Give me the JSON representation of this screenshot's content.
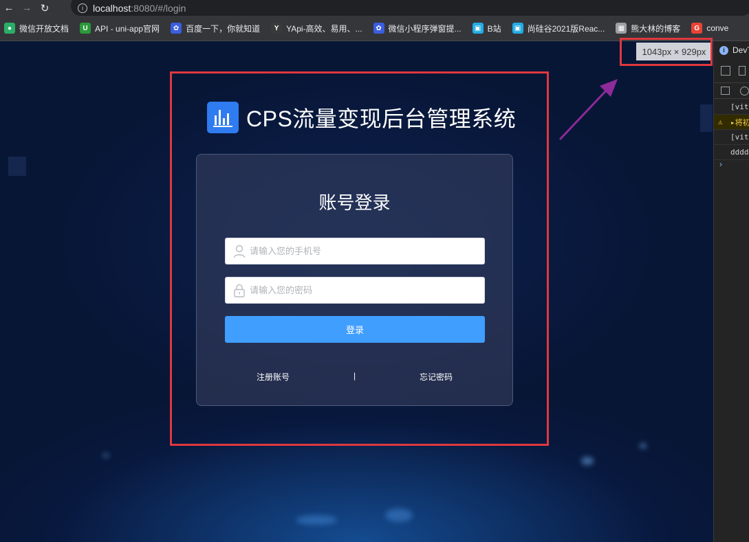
{
  "browser": {
    "url_host": "localhost",
    "url_rest": ":8080/#/login",
    "bookmarks": [
      {
        "label": "微信开放文档",
        "icon": "wechat-icon",
        "color": "#2aae67"
      },
      {
        "label": "API - uni-app官网",
        "icon": "uniapp-icon",
        "color": "#2b9939"
      },
      {
        "label": "百度一下，你就知道",
        "icon": "baidu-icon",
        "color": "#3b5ee0"
      },
      {
        "label": "YApi-高效、易用、...",
        "icon": "yapi-icon",
        "color": "#3a3a3a"
      },
      {
        "label": "微信小程序弹窗提...",
        "icon": "baidu-icon",
        "color": "#3b5ee0"
      },
      {
        "label": "B站",
        "icon": "bilibili-icon",
        "color": "#23ade5"
      },
      {
        "label": "尚硅谷2021版Reac...",
        "icon": "bilibili-icon",
        "color": "#23ade5"
      },
      {
        "label": "熊大林的博客",
        "icon": "blog-avatar-icon",
        "color": "#9aa0a6"
      },
      {
        "label": "conve",
        "icon": "google-icon",
        "color": "#ea4335"
      }
    ]
  },
  "page": {
    "brand_title": "CPS流量变现后台管理系统",
    "card_title": "账号登录",
    "phone_placeholder": "请输入您的手机号",
    "password_placeholder": "请输入您的密码",
    "login_label": "登录",
    "register_label": "注册账号",
    "separator": "|",
    "forgot_label": "忘记密码",
    "accent_color": "#409eff"
  },
  "overlay": {
    "size_badge": "1043px × 929px"
  },
  "devtools": {
    "tab_label": "DevT",
    "rows": [
      "[vit",
      "▸将初",
      "[vit",
      "dddd"
    ]
  }
}
